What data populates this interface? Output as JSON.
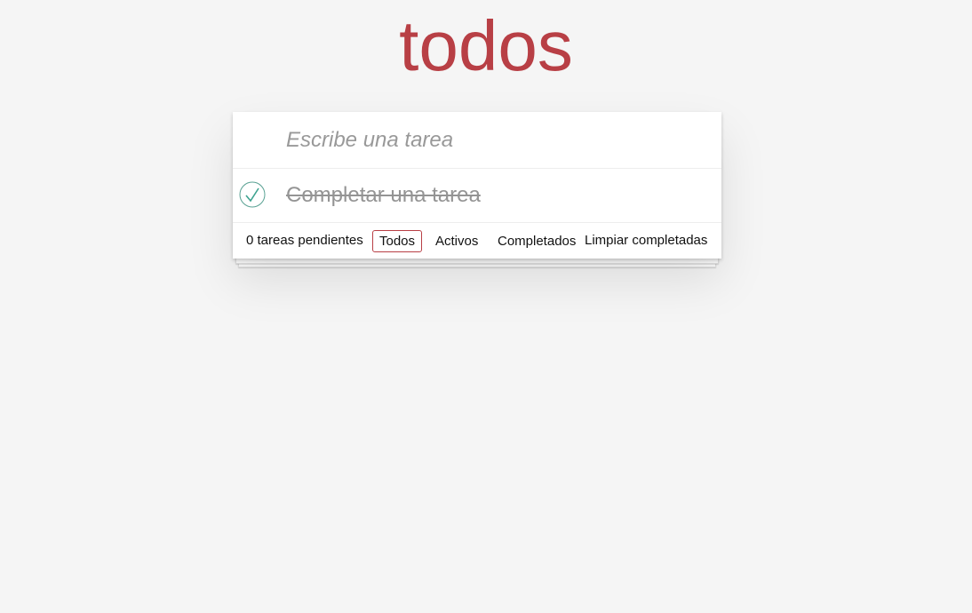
{
  "header": {
    "title": "todos"
  },
  "new_todo": {
    "placeholder": "Escribe una tarea",
    "value": ""
  },
  "todos": [
    {
      "label": "Completar una tarea",
      "completed": true
    }
  ],
  "footer": {
    "count_text": "0 tareas pendientes",
    "filters": [
      {
        "label": "Todos",
        "selected": true
      },
      {
        "label": "Activos",
        "selected": false
      },
      {
        "label": "Completados",
        "selected": false
      }
    ],
    "clear_completed": "Limpiar completadas"
  },
  "colors": {
    "brand": "#b83f45",
    "check": "#59a193",
    "background": "#f5f5f5"
  },
  "icons": {
    "toggle": "check-circle-icon"
  }
}
